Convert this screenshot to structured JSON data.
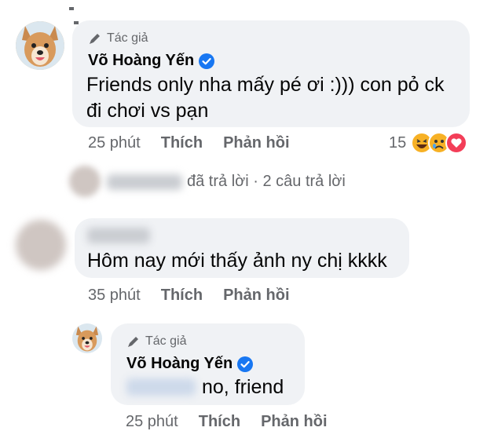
{
  "comments": [
    {
      "badge": "Tác giả",
      "author": "Võ Hoàng Yến",
      "text_line1": "Friends only nha mấy pé ơi :))) con pỏ ck",
      "text_line2": "đi chơi vs pạn",
      "time": "25 phút",
      "like": "Thích",
      "reply": "Phản hồi",
      "reaction_count": "15"
    },
    {
      "text": "Hôm nay mới thấy ảnh ny chị kkkk",
      "time": "35 phút",
      "like": "Thích",
      "reply": "Phản hồi"
    },
    {
      "badge": "Tác giả",
      "author": "Võ Hoàng Yến",
      "text": "no, friend",
      "time": "25 phút",
      "like": "Thích",
      "reply": "Phản hồi"
    }
  ],
  "replies_summary": "đã trả lời · 2 câu trả lời",
  "icons": {
    "badge": "pen-icon",
    "verified": "verified-badge-icon",
    "reactions": [
      "haha-reaction-icon",
      "sad-reaction-icon",
      "love-reaction-icon"
    ]
  },
  "colors": {
    "verified": "#1877f2",
    "bubble": "#f0f2f5",
    "meta": "#65676b",
    "love": "#f33e58",
    "haha": "#f7b125"
  }
}
